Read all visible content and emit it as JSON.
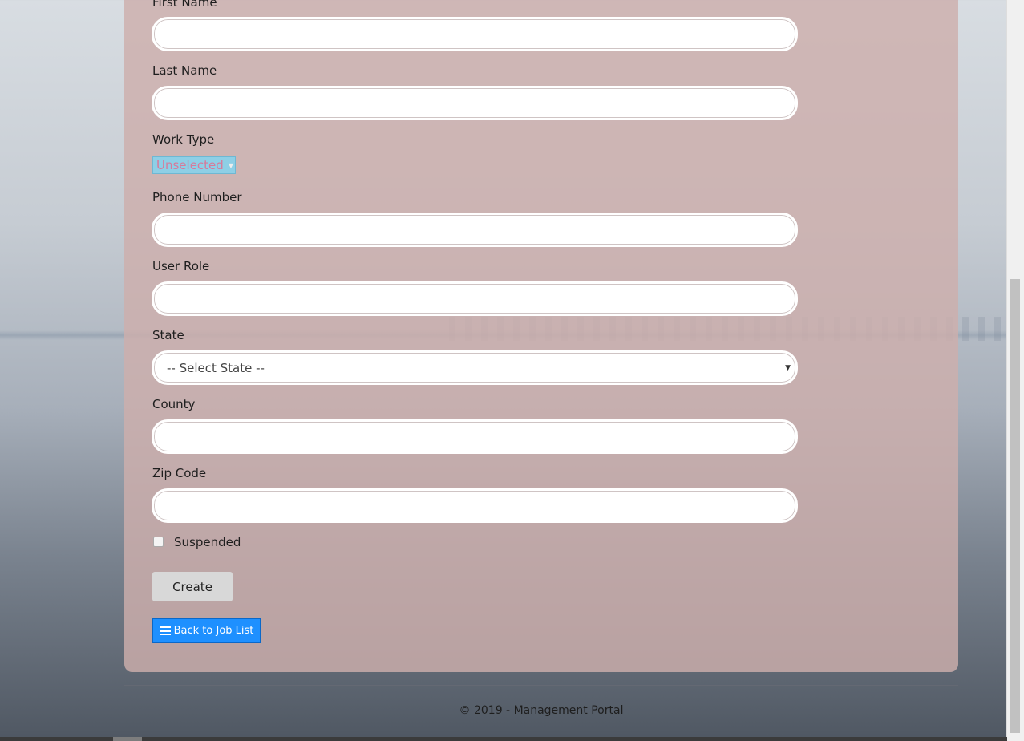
{
  "form": {
    "first_name_label": "First Name",
    "last_name_label": "Last Name",
    "work_type_label": "Work Type",
    "work_type_value": "Unselected",
    "phone_label": "Phone Number",
    "user_role_label": "User Role",
    "state_label": "State",
    "state_value": "-- Select State --",
    "county_label": "County",
    "zip_label": "Zip Code",
    "suspended_label": "Suspended",
    "create_label": "Create",
    "back_label": "Back to Job List"
  },
  "footer": {
    "text": "© 2019 - Management Portal"
  },
  "icons": {
    "back": "list-icon",
    "select_arrow": "chevron-down-icon"
  },
  "colors": {
    "back_button": "#1e90ff",
    "panel": "#cdafac",
    "worktype_bg": "#8ecfe6"
  }
}
